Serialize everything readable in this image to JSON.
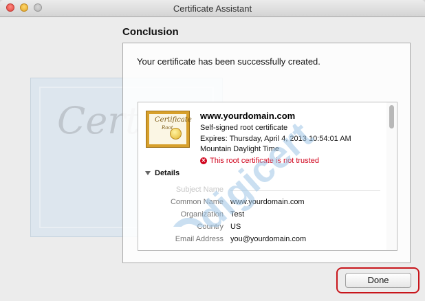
{
  "window": {
    "title": "Certificate Assistant"
  },
  "background": {
    "script_text": "Certif"
  },
  "heading": "Conclusion",
  "message": "Your certificate has been successfully created.",
  "certificate": {
    "icon_title": "Certificate",
    "icon_sub": "Root",
    "name": "www.yourdomain.com",
    "type_line": "Self-signed root certificate",
    "expires_line": "Expires: Thursday, April 4, 2013 10:54:01 AM",
    "timezone_line": "Mountain Daylight Time",
    "warning": "This root certificate is not trusted"
  },
  "details": {
    "toggle_label": "Details",
    "section_header": "Subject Name",
    "rows": [
      {
        "label": "Common Name",
        "value": "www.yourdomain.com"
      },
      {
        "label": "Organization",
        "value": "Test"
      },
      {
        "label": "Country",
        "value": "US"
      },
      {
        "label": "Email Address",
        "value": "you@yourdomain.com"
      }
    ]
  },
  "buttons": {
    "done": "Done"
  },
  "watermark": {
    "text": "digicert",
    "color": "#9fc6e6"
  },
  "colors": {
    "warning": "#d0021b",
    "highlight": "#c8151b"
  }
}
